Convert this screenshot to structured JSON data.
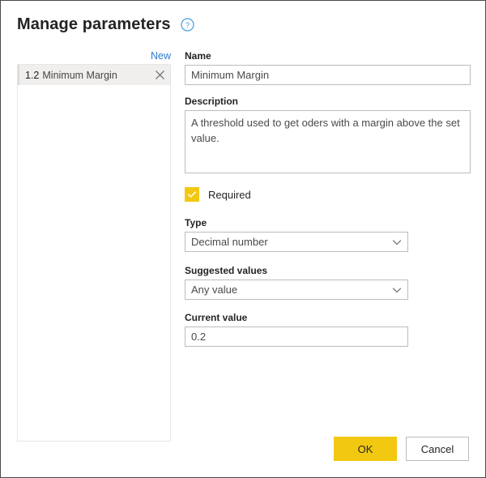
{
  "dialog": {
    "title": "Manage parameters",
    "help_icon": "help-circle-icon"
  },
  "left_panel": {
    "new_label": "New",
    "items": [
      {
        "index": "1.2",
        "label": "Minimum Margin",
        "close_icon": "close-icon"
      }
    ]
  },
  "form": {
    "name": {
      "label": "Name",
      "value": "Minimum Margin"
    },
    "description": {
      "label": "Description",
      "value": "A threshold used to get oders with a margin above the set value."
    },
    "required": {
      "label": "Required",
      "checked": true,
      "check_icon": "checkmark-icon"
    },
    "type": {
      "label": "Type",
      "value": "Decimal number",
      "chevron_icon": "chevron-down-icon"
    },
    "suggested_values": {
      "label": "Suggested values",
      "value": "Any value",
      "chevron_icon": "chevron-down-icon"
    },
    "current_value": {
      "label": "Current value",
      "value": "0.2"
    }
  },
  "footer": {
    "ok_label": "OK",
    "cancel_label": "Cancel"
  },
  "colors": {
    "accent_yellow": "#f2c811",
    "link_blue": "#2b7cd3",
    "help_blue": "#3e9ce0",
    "text_dark": "#252423",
    "border_gray": "#bcbcbc"
  }
}
